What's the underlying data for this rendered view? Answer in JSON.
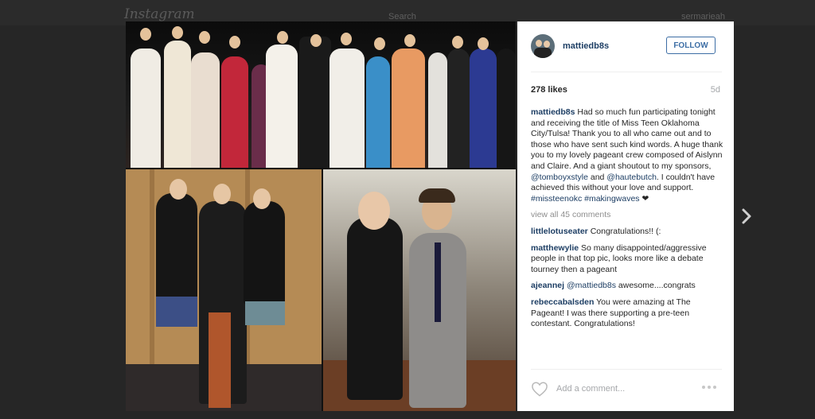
{
  "app": {
    "logo": "Instagram",
    "search_label": "Search",
    "current_user": "sermarieah"
  },
  "post": {
    "username": "mattiedb8s",
    "follow_label": "FOLLOW",
    "likes": "278 likes",
    "age": "5d",
    "caption": {
      "username": "mattiedb8s",
      "part1": "Had so much fun participating tonight and receiving the title of Miss Teen Oklahoma City/Tulsa! Thank you to all who came out and to those who have sent such kind words. A huge thank you to my lovely pageant crew composed of Aislynn and Claire. And a giant shoutout to my sponsors, ",
      "mention1": "@tomboyxstyle",
      "part2": " and ",
      "mention2": "@hautebutch",
      "part3": ". I couldn't have achieved this without your love and support. ",
      "tags": "#missteenokc #makingwaves",
      "emoji": "❤"
    },
    "view_all": "view all 45 comments",
    "comments": [
      {
        "user": "littlelotuseater",
        "text": "Congratulations!! (:"
      },
      {
        "user": "matthewylie",
        "text": "So many disappointed/aggressive people in that top pic, looks more like a debate tourney then a pageant"
      },
      {
        "user": "ajeannej",
        "mention": "@mattiedb8s",
        "text": "awesome....congrats"
      },
      {
        "user": "rebeccabalsden",
        "text": "You were amazing at The Pageant! I was there supporting a pre-teen contestant. Congratulations!"
      }
    ],
    "add_comment_placeholder": "Add a comment...",
    "icons": {
      "like": "heart-icon",
      "more": "more-options-icon",
      "next": "chevron-right-icon"
    }
  }
}
